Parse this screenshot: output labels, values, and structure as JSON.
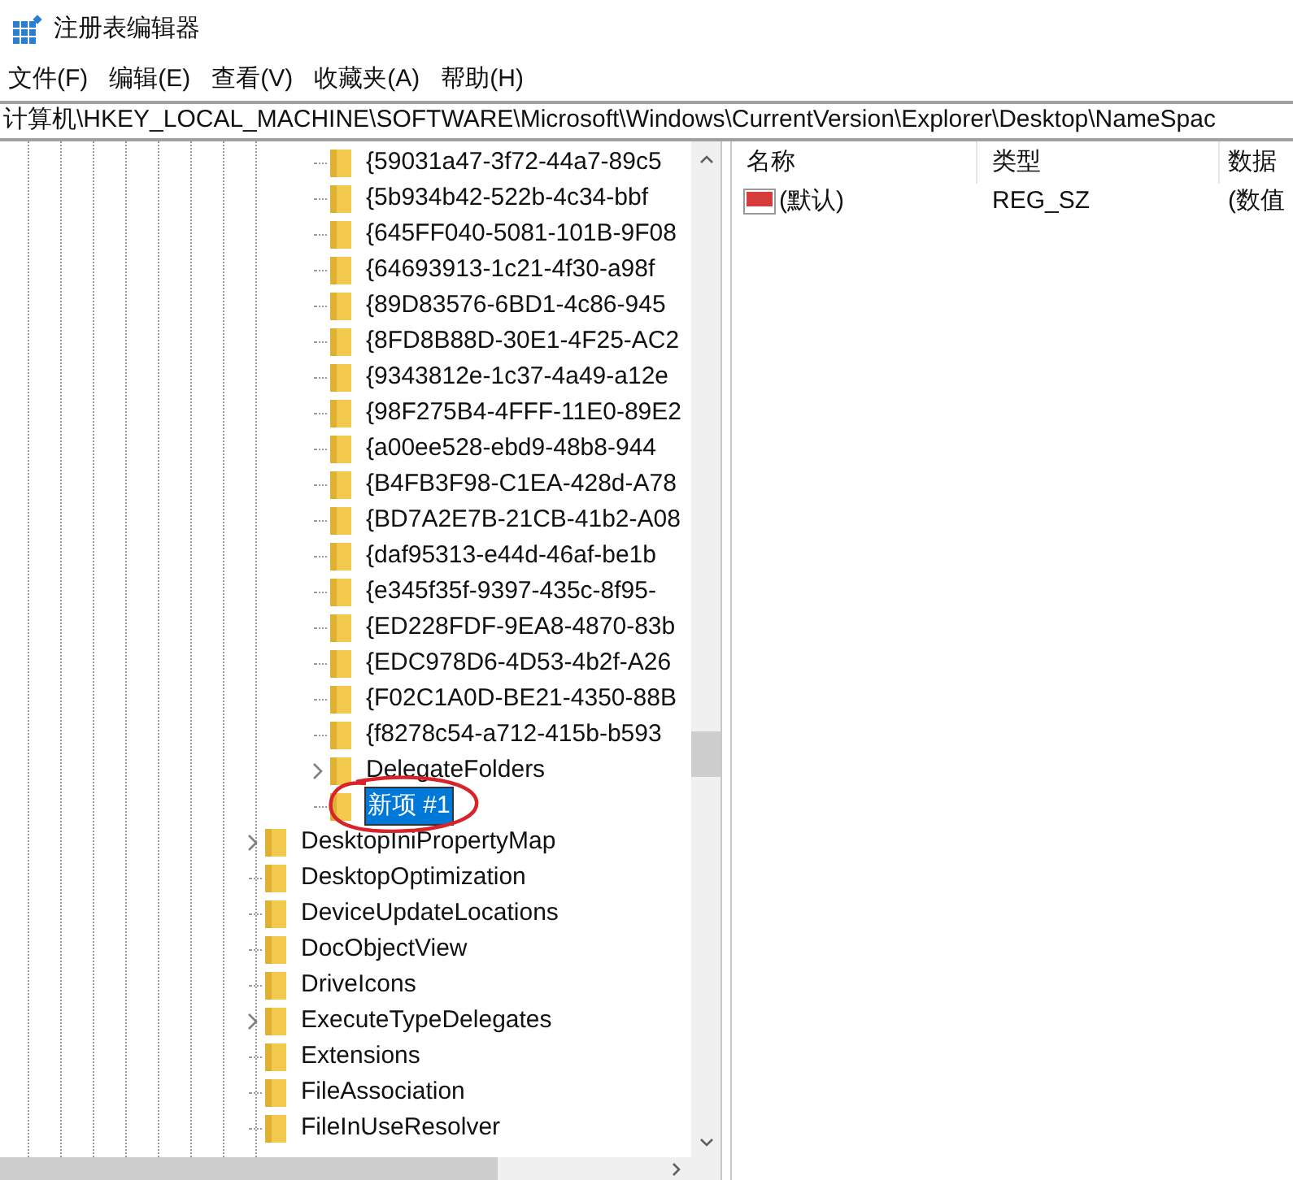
{
  "window": {
    "title": "注册表编辑器"
  },
  "menu": [
    "文件(F)",
    "编辑(E)",
    "查看(V)",
    "收藏夹(A)",
    "帮助(H)"
  ],
  "address": "计算机\\HKEY_LOCAL_MACHINE\\SOFTWARE\\Microsoft\\Windows\\CurrentVersion\\Explorer\\Desktop\\NameSpac",
  "tree": {
    "open_key_children": [
      {
        "label": "{59031a47-3f72-44a7-89c5",
        "expandable": false,
        "selected": false
      },
      {
        "label": "{5b934b42-522b-4c34-bbf",
        "expandable": false,
        "selected": false
      },
      {
        "label": "{645FF040-5081-101B-9F08",
        "expandable": false,
        "selected": false
      },
      {
        "label": "{64693913-1c21-4f30-a98f",
        "expandable": false,
        "selected": false
      },
      {
        "label": "{89D83576-6BD1-4c86-945",
        "expandable": false,
        "selected": false
      },
      {
        "label": "{8FD8B88D-30E1-4F25-AC2",
        "expandable": false,
        "selected": false
      },
      {
        "label": "{9343812e-1c37-4a49-a12e",
        "expandable": false,
        "selected": false
      },
      {
        "label": "{98F275B4-4FFF-11E0-89E2",
        "expandable": false,
        "selected": false
      },
      {
        "label": "{a00ee528-ebd9-48b8-944",
        "expandable": false,
        "selected": false
      },
      {
        "label": "{B4FB3F98-C1EA-428d-A78",
        "expandable": false,
        "selected": false
      },
      {
        "label": "{BD7A2E7B-21CB-41b2-A08",
        "expandable": false,
        "selected": false
      },
      {
        "label": "{daf95313-e44d-46af-be1b",
        "expandable": false,
        "selected": false
      },
      {
        "label": "{e345f35f-9397-435c-8f95-",
        "expandable": false,
        "selected": false
      },
      {
        "label": "{ED228FDF-9EA8-4870-83b",
        "expandable": false,
        "selected": false
      },
      {
        "label": "{EDC978D6-4D53-4b2f-A26",
        "expandable": false,
        "selected": false
      },
      {
        "label": "{F02C1A0D-BE21-4350-88B",
        "expandable": false,
        "selected": false
      },
      {
        "label": "{f8278c54-a712-415b-b593",
        "expandable": false,
        "selected": false
      },
      {
        "label": "DelegateFolders",
        "expandable": true,
        "selected": false
      },
      {
        "label": "新项 #1",
        "expandable": false,
        "selected": true
      }
    ],
    "items": [
      {
        "label": "DesktopIniPropertyMap",
        "expandable": true,
        "selected": false
      },
      {
        "label": "DesktopOptimization",
        "expandable": false,
        "selected": false
      },
      {
        "label": "DeviceUpdateLocations",
        "expandable": false,
        "selected": false
      },
      {
        "label": "DocObjectView",
        "expandable": false,
        "selected": false
      },
      {
        "label": "DriveIcons",
        "expandable": false,
        "selected": false
      },
      {
        "label": "ExecuteTypeDelegates",
        "expandable": true,
        "selected": false
      },
      {
        "label": "Extensions",
        "expandable": false,
        "selected": false
      },
      {
        "label": "FileAssociation",
        "expandable": false,
        "selected": false
      },
      {
        "label": "FileInUseResolver",
        "expandable": false,
        "selected": false
      }
    ]
  },
  "values": {
    "columns": [
      "名称",
      "类型",
      "数据"
    ],
    "rows": [
      {
        "name": "(默认)",
        "type": "REG_SZ",
        "data": "(数值"
      }
    ]
  }
}
